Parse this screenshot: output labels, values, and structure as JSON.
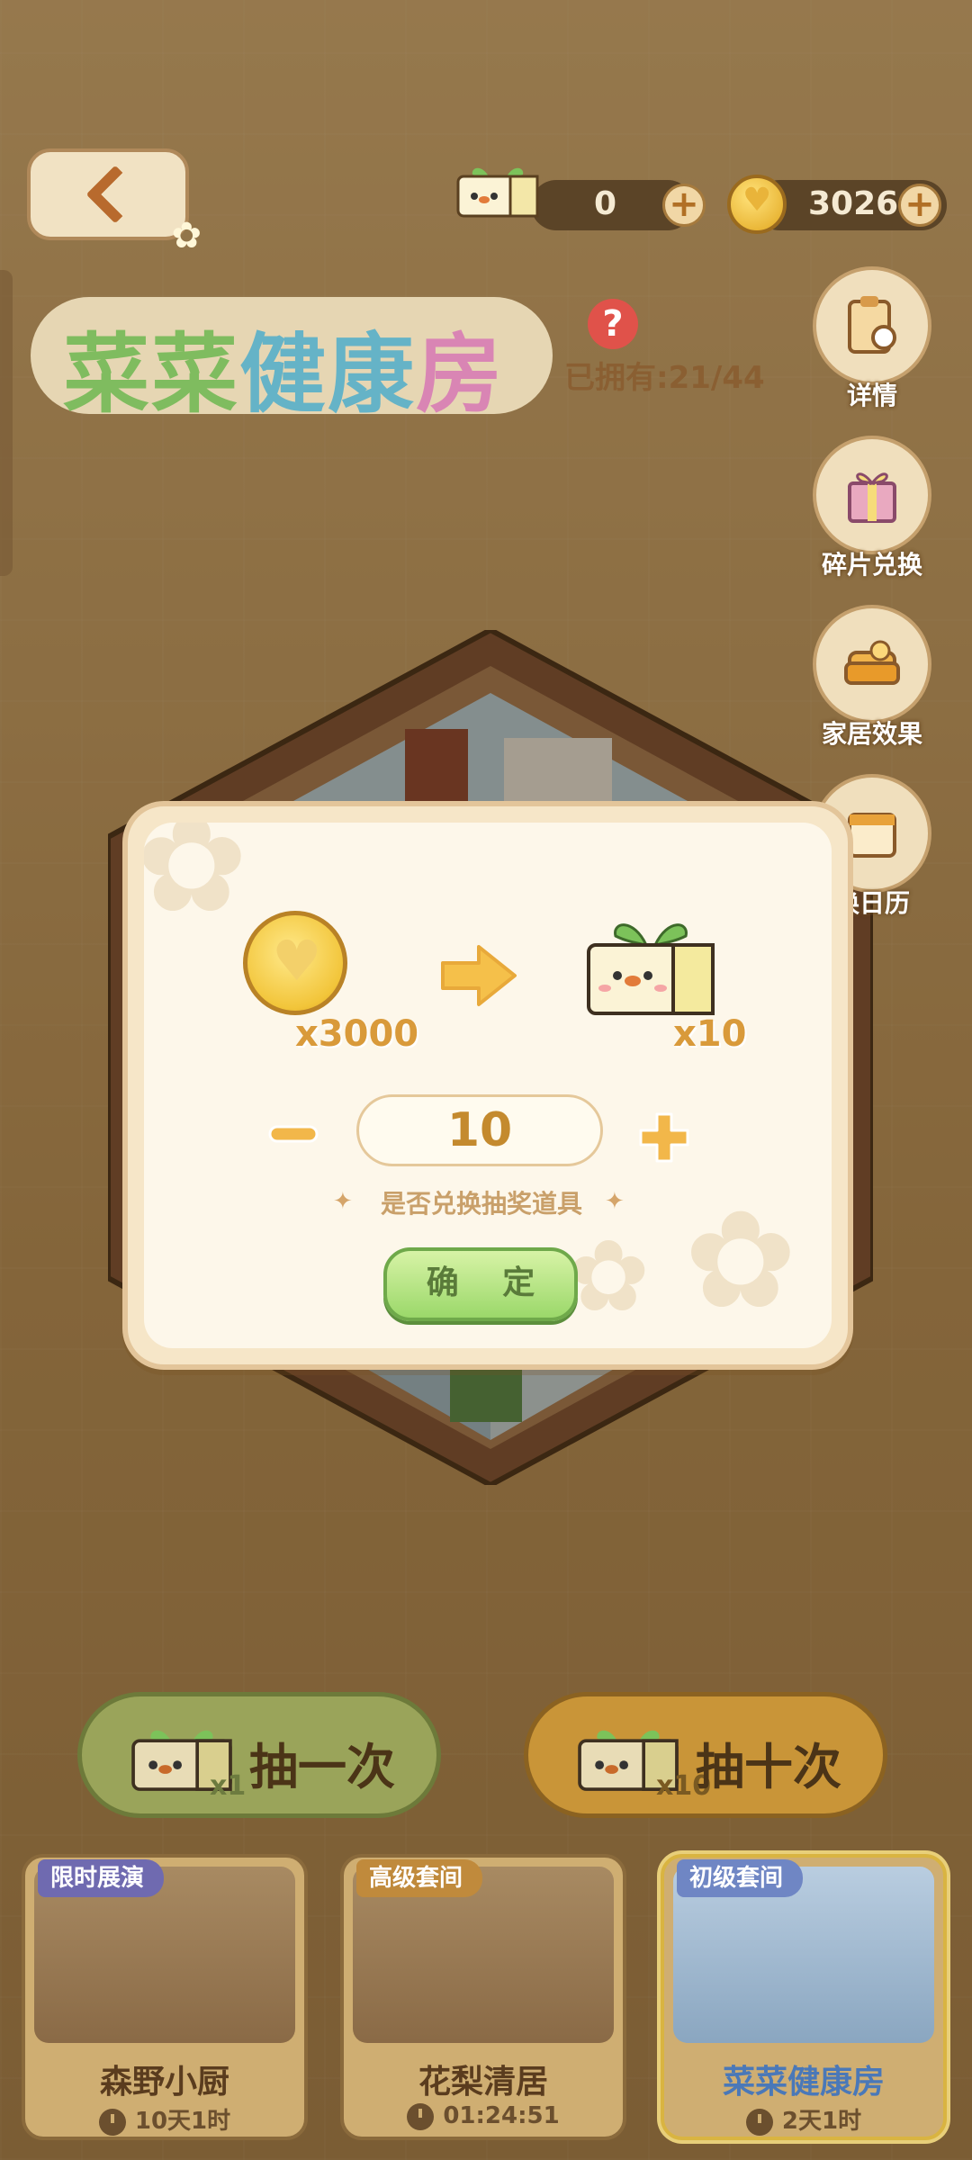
{
  "header": {
    "ticket_count": "0",
    "coin_count": "3026"
  },
  "room": {
    "title_part1": "菜菜",
    "title_part2": "健康",
    "title_part3": "房",
    "owned_label": "已拥有:21/44"
  },
  "side_menu": [
    {
      "label": "详情"
    },
    {
      "label": "碎片兑换"
    },
    {
      "label": "家居效果"
    },
    {
      "label": "换日历"
    }
  ],
  "dialog": {
    "coin_cost": "x3000",
    "ticket_gain": "x10",
    "quantity": "10",
    "hint": "是否兑换抽奖道具",
    "confirm_label": "确 定"
  },
  "draw": {
    "once_label": "抽一次",
    "once_mult": "x1",
    "ten_label": "抽十次",
    "ten_mult": "x10"
  },
  "cards": [
    {
      "tag": "限时展演",
      "tag_color": "#6f6ab0",
      "name": "森野小厨",
      "time": "10天1时"
    },
    {
      "tag": "高级套间",
      "tag_color": "#c08a3c",
      "name": "花梨清居",
      "time": "01:24:51"
    },
    {
      "tag": "初级套间",
      "tag_color": "#6f86c4",
      "name": "菜菜健康房",
      "name_color": "#4a78b8",
      "time": "2天1时"
    }
  ],
  "colors": {
    "accent": "#d99a3a",
    "confirm_green": "#9bd86a"
  }
}
